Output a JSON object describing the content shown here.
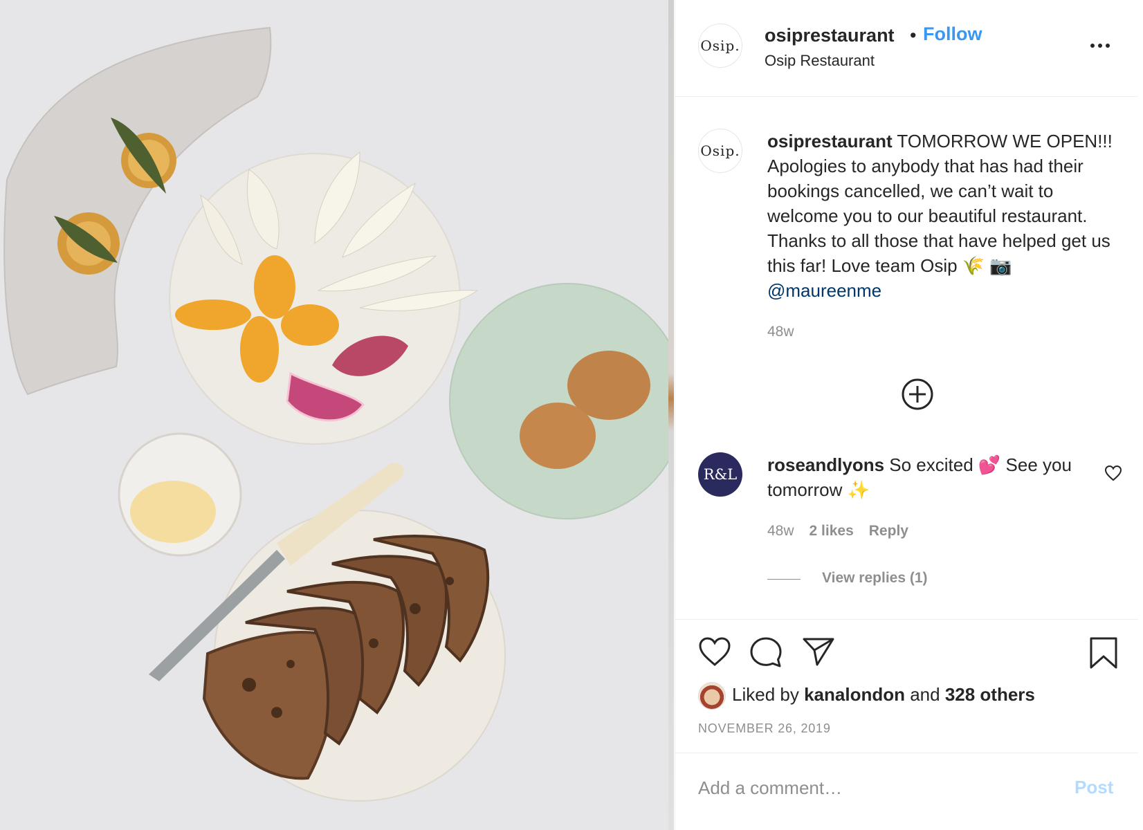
{
  "post": {
    "username": "osiprestaurant",
    "follow_label": "Follow",
    "separator": "•",
    "location": "Osip Restaurant",
    "avatar_text": "Osip.",
    "more_icon": "more-options-icon"
  },
  "caption": {
    "username": "osiprestaurant",
    "text": " TOMORROW WE OPEN!!! Apologies to anybody that has had their bookings cancelled, we can’t wait to welcome you to our beautiful restaurant. Thanks to all those that have helped get us this far! Love team Osip 🌾 📷 ",
    "mention": "@maureenme",
    "time": "48w"
  },
  "load_more_icon": "add-circle-icon",
  "comment": {
    "avatar_text": "R&L",
    "username": "roseandlyons",
    "text": " So excited 💕 See you tomorrow ✨",
    "time": "48w",
    "likes": "2 likes",
    "reply_label": "Reply",
    "view_replies": "View replies (1)"
  },
  "actions": {
    "like_icon": "heart-icon",
    "comment_icon": "comment-bubble-icon",
    "share_icon": "paper-plane-icon",
    "save_icon": "bookmark-icon"
  },
  "likes": {
    "prefix": "Liked by ",
    "user": "kanalondon",
    "middle": " and ",
    "others": "328 others"
  },
  "date": "NOVEMBER 26, 2019",
  "add_comment": {
    "placeholder": "Add a comment…",
    "post_label": "Post"
  },
  "colors": {
    "link_blue": "#3897f0",
    "post_disabled": "#b3dbff",
    "secondary_text": "#8e8e8e",
    "mention": "#00376b"
  }
}
